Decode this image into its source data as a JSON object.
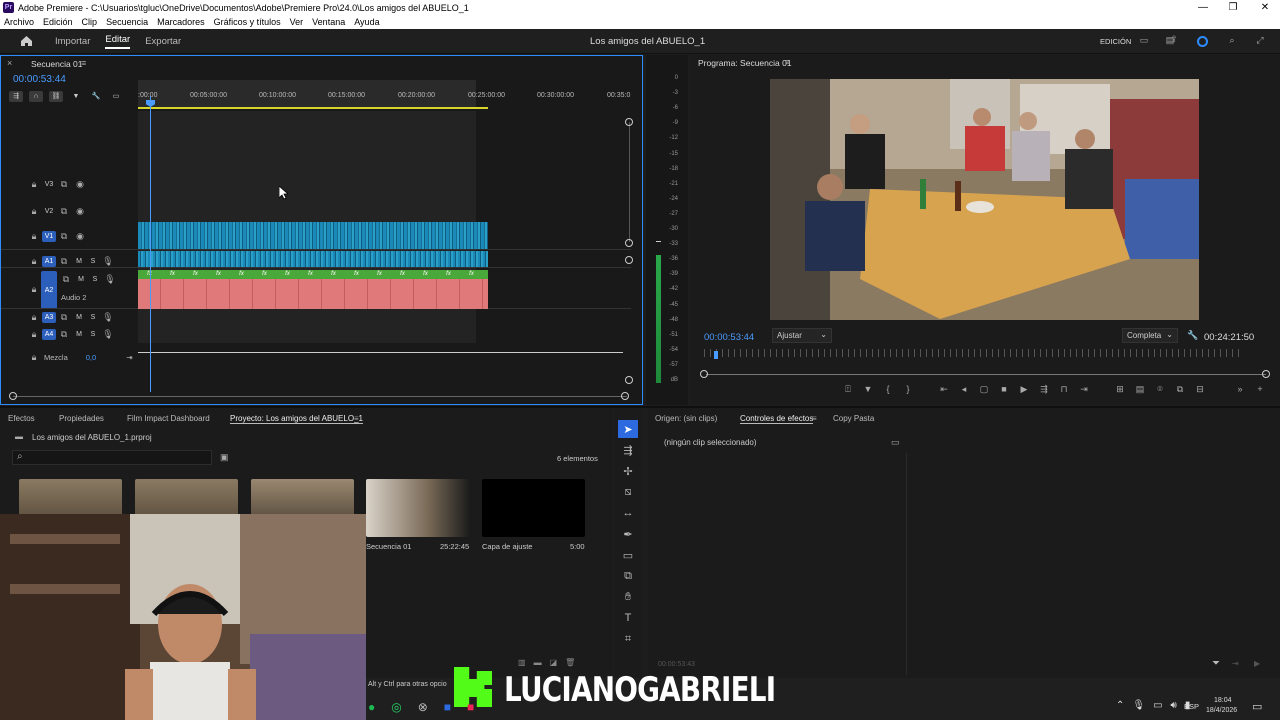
{
  "window": {
    "title": "Adobe Premiere - C:\\Usuarios\\tgluc\\OneDrive\\Documentos\\Adobe\\Premiere Pro\\24.0\\Los amigos del ABUELO_1",
    "logo": "Pr"
  },
  "menu": [
    "Archivo",
    "Edición",
    "Clip",
    "Secuencia",
    "Marcadores",
    "Gráficos y títulos",
    "Ver",
    "Ventana",
    "Ayuda"
  ],
  "header": {
    "tabs": [
      "Importar",
      "Editar",
      "Exportar"
    ],
    "active_tab": "Editar",
    "project_title": "Los amigos del ABUELO_1",
    "workspace": "EDICIÓN"
  },
  "timeline": {
    "tab": "Secuencia 01",
    "timecode": "00:00:53:44",
    "ruler": [
      ":00:00",
      "00:05:00:00",
      "00:10:00:00",
      "00:15:00:00",
      "00:20:00:00",
      "00:25:00:00",
      "00:30:00:00",
      "00:35:0"
    ],
    "tracks": [
      {
        "id": "V3",
        "label": ""
      },
      {
        "id": "V2",
        "label": ""
      },
      {
        "id": "V1",
        "label": ""
      },
      {
        "id": "A1",
        "label": ""
      },
      {
        "id": "A2",
        "label": "Audio 2"
      },
      {
        "id": "A3",
        "label": ""
      },
      {
        "id": "A4",
        "label": ""
      }
    ],
    "mix_label": "Mezcla",
    "mix_value": "0,0",
    "btn_m": "M",
    "btn_s": "S",
    "fx": "fx"
  },
  "vu_scale": [
    "0",
    "-3",
    "-6",
    "-9",
    "-12",
    "-15",
    "-18",
    "-21",
    "-24",
    "-27",
    "-30",
    "-33",
    "-36",
    "-39",
    "-42",
    "-45",
    "-48",
    "-51",
    "-54",
    "-57",
    "dB"
  ],
  "program": {
    "tab": "Programa: Secuencia 01",
    "timecode": "00:00:53:44",
    "fit": "Ajustar",
    "quality": "Completa",
    "duration": "00:24:21:50"
  },
  "project": {
    "tabs": [
      "Efectos",
      "Propiedades",
      "Film Impact Dashboard",
      "Proyecto: Los amigos del ABUELO_1"
    ],
    "file": "Los amigos del ABUELO_1.prproj",
    "count": "6 elementos",
    "items": [
      {
        "name": "Secuencia 01",
        "duration": "25:22:45"
      },
      {
        "name": "Capa de ajuste",
        "duration": "5:00"
      }
    ],
    "hint": "Alt y Ctrl para otras opcio"
  },
  "effects_panel": {
    "tabs": [
      "Origen: (sin clips)",
      "Controles de efectos",
      "Copy Pasta"
    ],
    "empty": "(ningún clip seleccionado)",
    "timecode": "00:00:53:43"
  },
  "overlay": {
    "name": "LUCIANOGABRIELI"
  },
  "taskbar": {
    "lang": "ESP",
    "time": "18:04",
    "date": "18/4/2026"
  },
  "colors": {
    "accent": "#2d8cff",
    "video_clip": "#1c8ab8",
    "audio_clip": "#e07a7a",
    "fx_bar": "#4aa83a",
    "kick_green": "#53fc18"
  }
}
